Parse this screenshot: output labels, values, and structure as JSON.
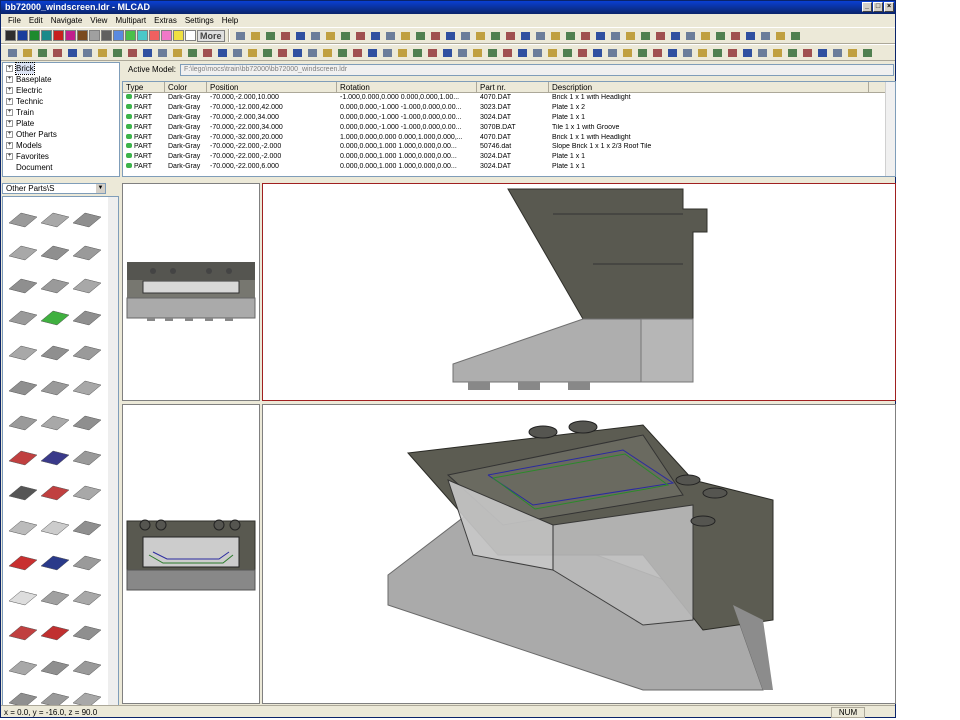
{
  "window": {
    "title": "bb72000_windscreen.ldr - MLCAD"
  },
  "menu": [
    "File",
    "Edit",
    "Navigate",
    "View",
    "Multipart",
    "Extras",
    "Settings",
    "Help"
  ],
  "toolbar": {
    "more_label": "More"
  },
  "colors": [
    "#2e2e2e",
    "#1a3d9c",
    "#1e8a2e",
    "#1a8a8a",
    "#c8201e",
    "#c21e8c",
    "#7a4a1e",
    "#a0a0a0",
    "#606060",
    "#5a8ae0",
    "#4ac04a",
    "#4ac8c8",
    "#f06060",
    "#f078c8",
    "#f0e040",
    "#ffffff"
  ],
  "tree": {
    "items": [
      {
        "label": "Brick",
        "selected": true
      },
      {
        "label": "Baseplate"
      },
      {
        "label": "Electric"
      },
      {
        "label": "Technic"
      },
      {
        "label": "Train"
      },
      {
        "label": "Plate"
      },
      {
        "label": "Other Parts"
      },
      {
        "label": "Models"
      },
      {
        "label": "Favorites"
      },
      {
        "label": "Document"
      }
    ]
  },
  "model": {
    "label": "Active Model:",
    "path": "F:\\lego\\mocs\\train\\bb72000\\bb72000_windscreen.ldr"
  },
  "parts_table": {
    "headers": [
      "Type",
      "Color",
      "Position",
      "Rotation",
      "Part nr.",
      "Description"
    ],
    "rows": [
      [
        "PART",
        "Dark-Gray",
        "-70.000,-2.000,10.000",
        "-1.000,0.000,0.000 0.000,0.000,1.00...",
        "4070.DAT",
        "Brick  1 x  1 with Headlight"
      ],
      [
        "PART",
        "Dark-Gray",
        "-70.000,-12.000,42.000",
        "0.000,0.000,-1.000 -1.000,0.000,0.00...",
        "3023.DAT",
        "Plate  1 x  2"
      ],
      [
        "PART",
        "Dark-Gray",
        "-70.000,-2.000,34.000",
        "0.000,0.000,-1.000 -1.000,0.000,0.00...",
        "3024.DAT",
        "Plate  1 x  1"
      ],
      [
        "PART",
        "Dark-Gray",
        "-70.000,-22.000,34.000",
        "0.000,0.000,-1.000 -1.000,0.000,0.00...",
        "3070B.DAT",
        "Tile  1 x  1 with Groove"
      ],
      [
        "PART",
        "Dark-Gray",
        "-70.000,-32.000,20.000",
        "1.000,0.000,0.000 0.000,1.000,0.000,...",
        "4070.DAT",
        "Brick  1 x  1 with Headlight"
      ],
      [
        "PART",
        "Dark-Gray",
        "-70.000,-22.000,-2.000",
        "0.000,0.000,1.000 1.000,0.000,0.00...",
        "50746.dat",
        "Slope Brick  1 x  1 x 2/3 Roof Tile"
      ],
      [
        "PART",
        "Dark-Gray",
        "-70.000,-22.000,-2.000",
        "0.000,0.000,1.000 1.000,0.000,0.00...",
        "3024.DAT",
        "Plate  1 x  1"
      ],
      [
        "PART",
        "Dark-Gray",
        "-70.000,-22.000,6.000",
        "0.000,0.000,1.000 1.000,0.000,0.00...",
        "3024.DAT",
        "Plate  1 x  1"
      ]
    ]
  },
  "part_selector": {
    "value": "Other Parts\\S"
  },
  "status": {
    "coords": "x = 0.0, y = -16.0, z = 90.0",
    "num": "NUM"
  }
}
